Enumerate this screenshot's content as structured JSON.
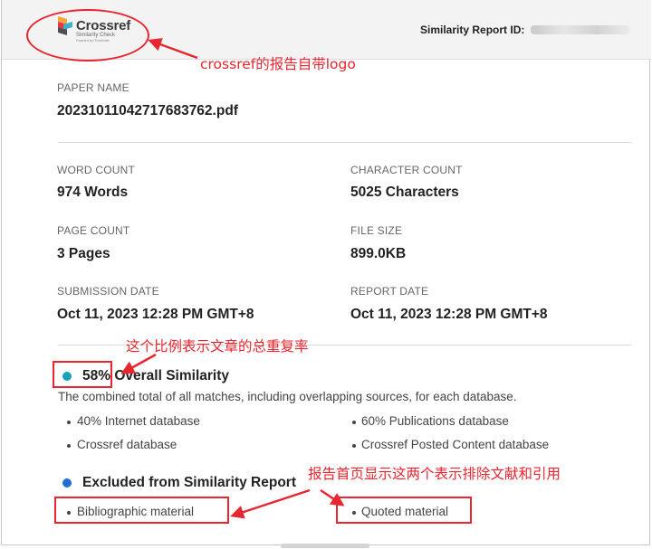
{
  "header": {
    "logo": {
      "brand": "Crossref",
      "subtitle": "Similarity Check",
      "tagline": "Powered by iThenticate"
    },
    "report_id_label": "Similarity Report ID:"
  },
  "paper": {
    "label": "PAPER NAME",
    "value": "20231011042717683762.pdf"
  },
  "fields": {
    "word_count": {
      "label": "WORD COUNT",
      "value": "974 Words"
    },
    "character_count": {
      "label": "CHARACTER COUNT",
      "value": "5025 Characters"
    },
    "page_count": {
      "label": "PAGE COUNT",
      "value": "3 Pages"
    },
    "file_size": {
      "label": "FILE SIZE",
      "value": "899.0KB"
    },
    "submission_date": {
      "label": "SUBMISSION DATE",
      "value": "Oct 11, 2023 12:28 PM GMT+8"
    },
    "report_date": {
      "label": "REPORT DATE",
      "value": "Oct 11, 2023 12:28 PM GMT+8"
    }
  },
  "similarity": {
    "percent": "58%",
    "title": "Overall Similarity",
    "dot_color": "#17a2b8",
    "description": "The combined total of all matches, including overlapping sources, for each database.",
    "databases": [
      "40% Internet database",
      "60% Publications database",
      "Crossref database",
      "Crossref Posted Content database"
    ]
  },
  "excluded": {
    "title": "Excluded from Similarity Report",
    "dot_color": "#1f6fd1",
    "items": [
      "Bibliographic material",
      "Quoted material"
    ]
  },
  "annotations": {
    "logo_note": "crossref的报告自带logo",
    "ratio_note": "这个比例表示文章的总重复率",
    "excluded_note": "报告首页显示这两个表示排除文献和引用",
    "color": "#e8262f"
  }
}
